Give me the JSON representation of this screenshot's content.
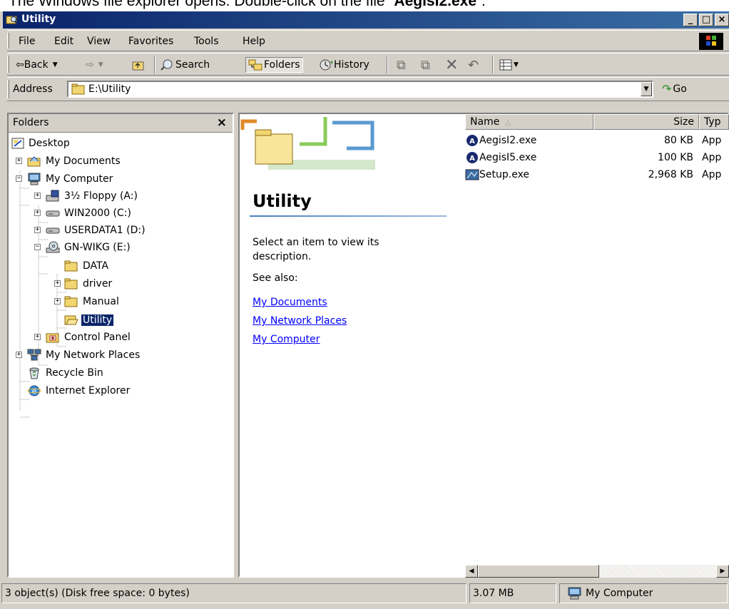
{
  "caption": {
    "text": "The Windows file explorer opens. Double-click on the file “",
    "bold": "AegisI2.exe",
    "end": "”."
  },
  "window": {
    "title": "Utility"
  },
  "menu": [
    "File",
    "Edit",
    "View",
    "Favorites",
    "Tools",
    "Help"
  ],
  "toolbar": {
    "back": "Back",
    "search": "Search",
    "folders": "Folders",
    "history": "History"
  },
  "address": {
    "label": "Address",
    "value": "E:\\Utility",
    "go": "Go"
  },
  "folders_pane": {
    "title": "Folders",
    "tree": [
      {
        "label": "Desktop",
        "icon": "desktop-icon"
      },
      {
        "label": "My Documents",
        "icon": "my-documents-icon"
      },
      {
        "label": "My Computer",
        "icon": "my-computer-icon"
      },
      {
        "label": "3½ Floppy (A:)",
        "icon": "floppy-drive-icon"
      },
      {
        "label": "WIN2000 (C:)",
        "icon": "hard-drive-icon"
      },
      {
        "label": "USERDATA1 (D:)",
        "icon": "hard-drive-icon"
      },
      {
        "label": "GN-WIKG (E:)",
        "icon": "cd-drive-icon"
      },
      {
        "label": "DATA",
        "icon": "folder-icon"
      },
      {
        "label": "driver",
        "icon": "folder-icon"
      },
      {
        "label": "Manual",
        "icon": "folder-icon"
      },
      {
        "label": "Utility",
        "icon": "open-folder-icon"
      },
      {
        "label": "Control Panel",
        "icon": "control-panel-icon"
      },
      {
        "label": "My Network Places",
        "icon": "network-places-icon"
      },
      {
        "label": "Recycle Bin",
        "icon": "recycle-bin-icon"
      },
      {
        "label": "Internet Explorer",
        "icon": "internet-explorer-icon"
      }
    ]
  },
  "info_panel": {
    "title": "Utility",
    "description": "Select an item to view its description.",
    "see_also": "See also:",
    "links": [
      "My Documents",
      "My Network Places",
      "My Computer"
    ]
  },
  "file_list": {
    "columns": {
      "name": "Name",
      "size": "Size",
      "type": "Typ"
    },
    "rows": [
      {
        "name": "AegisI2.exe",
        "size": "80 KB",
        "type": "App",
        "icon": "aegis-icon"
      },
      {
        "name": "AegisI5.exe",
        "size": "100 KB",
        "type": "App",
        "icon": "aegis-icon"
      },
      {
        "name": "Setup.exe",
        "size": "2,968 KB",
        "type": "App",
        "icon": "setup-icon"
      }
    ]
  },
  "status": {
    "objects": "3 object(s) (Disk free space: 0 bytes)",
    "size": "3.07 MB",
    "zone": "My Computer"
  },
  "colors": {
    "title_start": "#0a246a",
    "title_end": "#3a6ea5",
    "chrome": "#d4d0c8",
    "link": "#0000ff",
    "selection": "#0a246a"
  }
}
